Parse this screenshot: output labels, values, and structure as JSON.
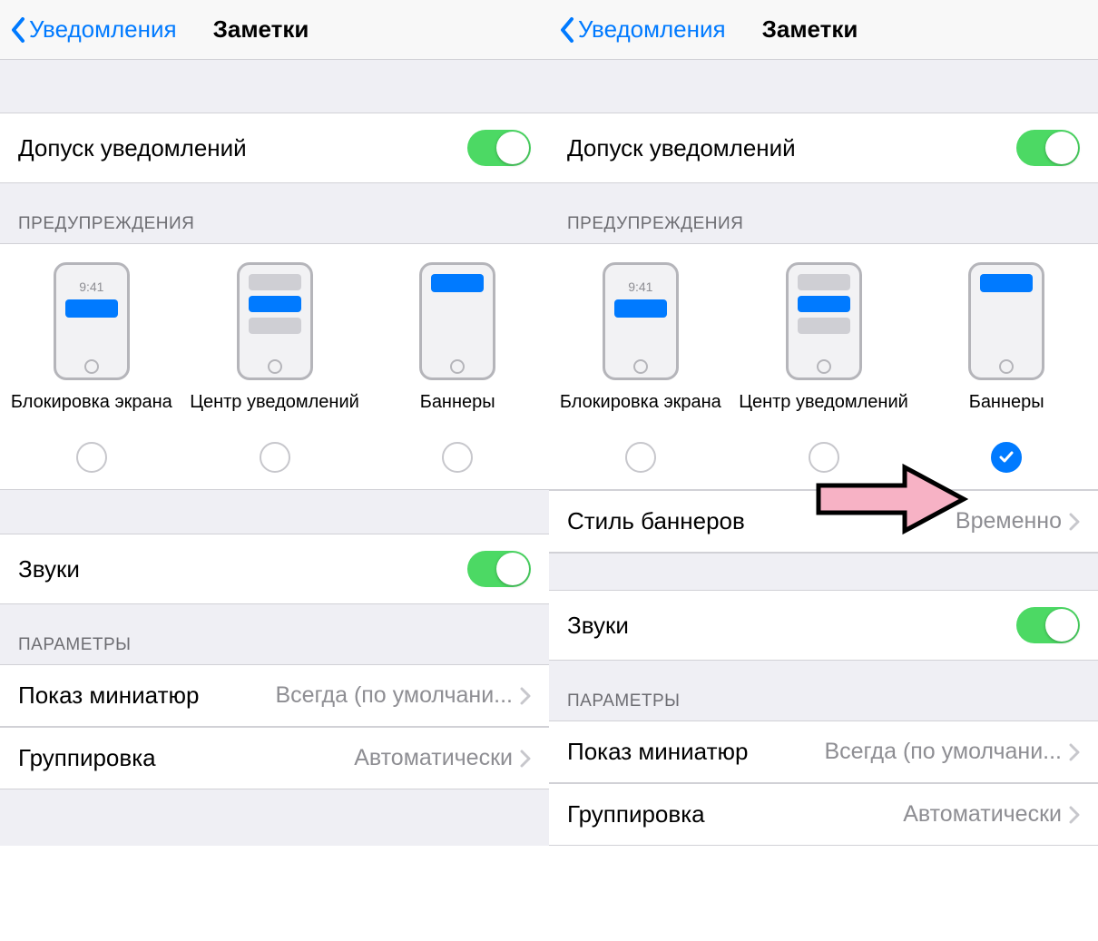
{
  "nav": {
    "back": "Уведомления",
    "title": "Заметки"
  },
  "allow": {
    "label": "Допуск уведомлений",
    "on": true
  },
  "alerts": {
    "header": "ПРЕДУПРЕЖДЕНИЯ",
    "time": "9:41",
    "items": [
      {
        "label": "Блокировка экрана"
      },
      {
        "label": "Центр уведомлений"
      },
      {
        "label": "Баннеры"
      }
    ]
  },
  "bannerStyle": {
    "label": "Стиль баннеров",
    "value": "Временно"
  },
  "sounds": {
    "label": "Звуки",
    "on": true
  },
  "options": {
    "header": "ПАРАМЕТРЫ",
    "preview": {
      "label": "Показ миниатюр",
      "value": "Всегда (по умолчани..."
    },
    "grouping": {
      "label": "Группировка",
      "value": "Автоматически"
    }
  },
  "right": {
    "banners_checked": true
  }
}
